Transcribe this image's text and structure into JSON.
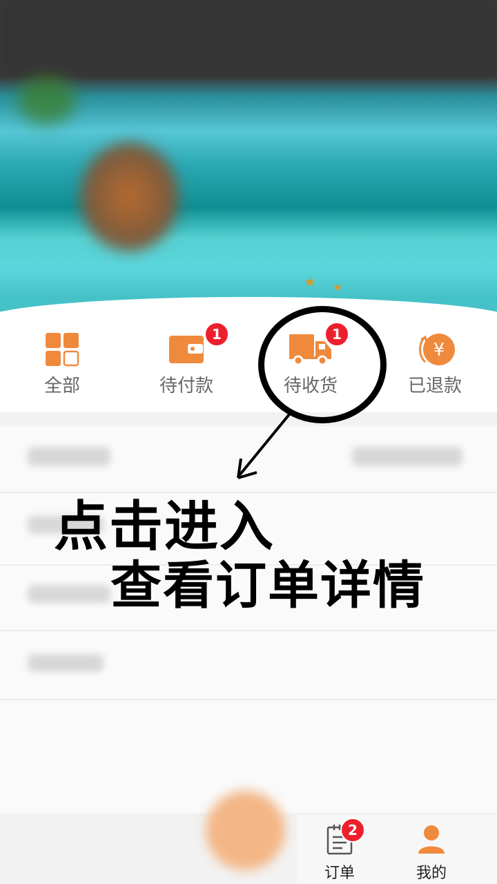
{
  "order_tabs": [
    {
      "label": "全部",
      "icon": "grid-icon",
      "badge": ""
    },
    {
      "label": "待付款",
      "icon": "wallet-icon",
      "badge": "1"
    },
    {
      "label": "待收货",
      "icon": "truck-icon",
      "badge": "1"
    },
    {
      "label": "已退款",
      "icon": "refund-yen-icon",
      "badge": ""
    }
  ],
  "refund_symbol": "¥",
  "annotation": {
    "line1": "点击进入",
    "line2": "查看订单详情"
  },
  "bottom_nav": [
    {
      "label": "订单",
      "icon": "order-list-icon",
      "badge": "2"
    },
    {
      "label": "我的",
      "icon": "profile-icon",
      "badge": ""
    }
  ],
  "colors": {
    "accent": "#ef8a3d",
    "badge": "#ee1f2c"
  }
}
